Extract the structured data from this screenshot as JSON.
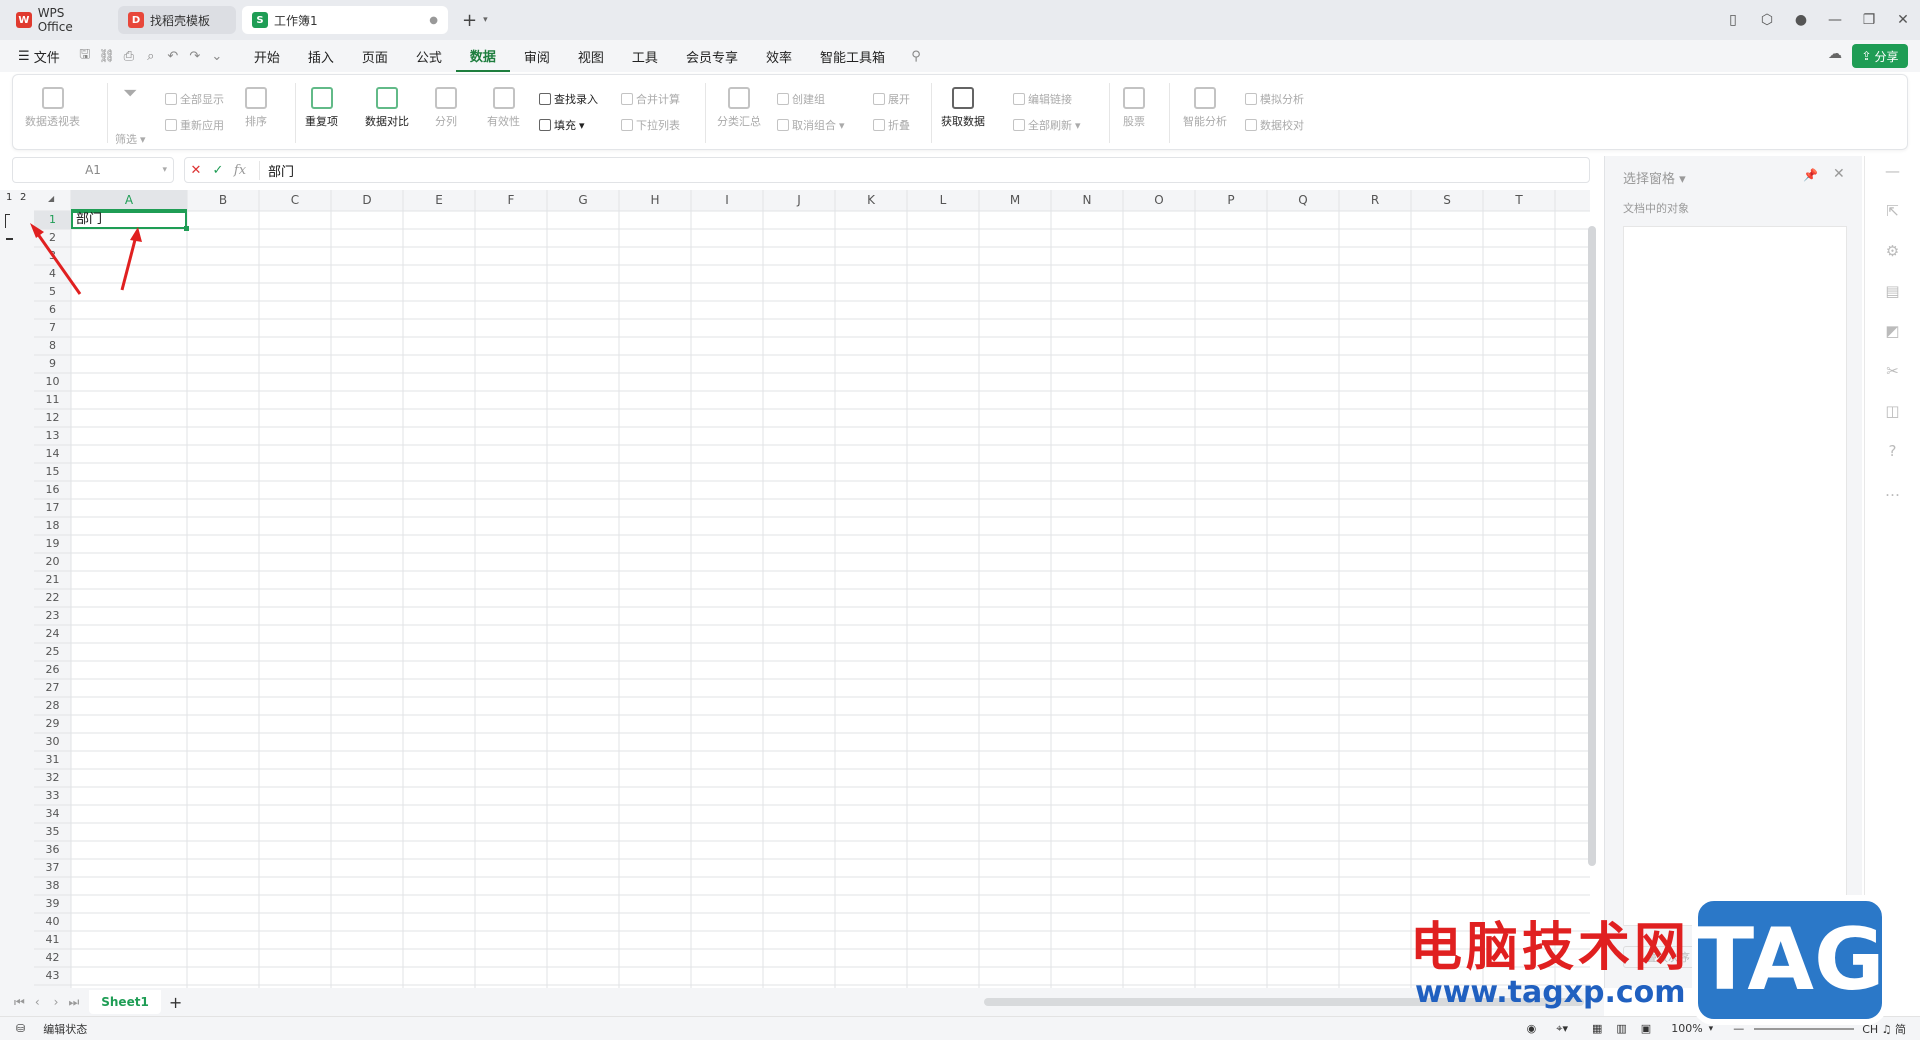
{
  "titlebar": {
    "tabs": [
      {
        "label": "WPS Office"
      },
      {
        "label": "找稻壳模板"
      },
      {
        "label": "工作簿1"
      }
    ]
  },
  "menubar": {
    "file": "文件",
    "items": [
      "开始",
      "插入",
      "页面",
      "公式",
      "数据",
      "审阅",
      "视图",
      "工具",
      "会员专享",
      "效率",
      "智能工具箱"
    ],
    "active": "数据",
    "share": "分享"
  },
  "ribbon": {
    "big": [
      "数据透视表",
      "重复项",
      "数据对比",
      "分列",
      "有效性",
      "分类汇总",
      "获取数据",
      "股票",
      "智能分析"
    ],
    "small": [
      "全部显示",
      "重新应用",
      "排序",
      "查找录入",
      "填充",
      "合并计算",
      "下拉列表",
      "创建组",
      "取消组合",
      "展开",
      "折叠",
      "编辑链接",
      "全部刷新",
      "模拟分析",
      "数据校对",
      "筛选"
    ]
  },
  "formula": {
    "name_box": "A1",
    "fx": "fx",
    "content": "部门"
  },
  "grid": {
    "columns": [
      "A",
      "B",
      "C",
      "D",
      "E",
      "F",
      "G",
      "H",
      "I",
      "J",
      "K",
      "L",
      "M",
      "N",
      "O",
      "P",
      "Q",
      "R",
      "S",
      "T"
    ],
    "outline_levels": [
      "1",
      "2"
    ],
    "cell_A1": "部门",
    "row_count": 43
  },
  "right_panel": {
    "title": "选择窗格",
    "subtitle": "文档中的对象",
    "order_btn": "叠放次序"
  },
  "sheets": {
    "active": "Sheet1",
    "add": "+"
  },
  "status": {
    "mode": "编辑状态",
    "zoom": "100%",
    "ime": "CH ♫ 简"
  },
  "watermark": {
    "text": "电脑技术网",
    "url": "www.tagxp.com",
    "logo": "TAG"
  }
}
